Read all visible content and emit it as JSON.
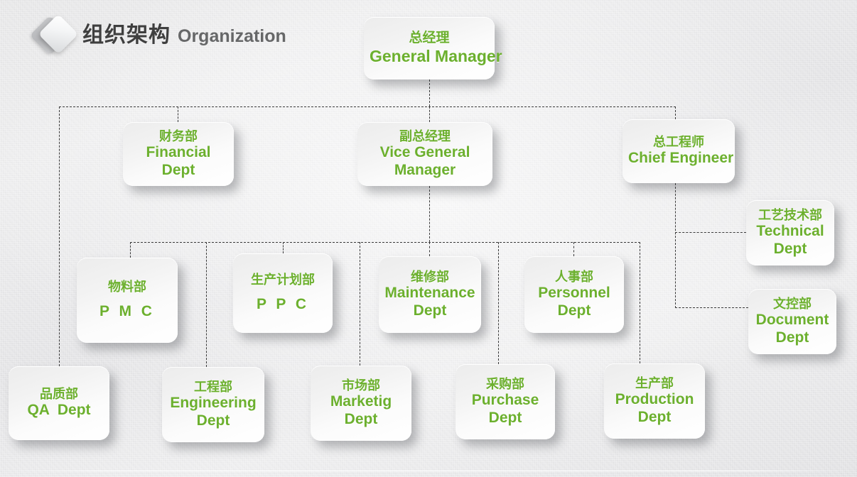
{
  "header": {
    "logo_icon": "diamond-logo-icon",
    "title_cn": "组织架构",
    "title_en": "Organization",
    "title_color": "#3f3f3f"
  },
  "theme": {
    "node_text_color": "#6cb02e",
    "connector_color": "#3a3a3a",
    "background": "#ebebec"
  },
  "chart_data": {
    "type": "diagram",
    "title": "组织架构 Organization",
    "nodes": [
      {
        "id": "gm",
        "cn": "总经理",
        "en": "General Manager",
        "level": 0
      },
      {
        "id": "financial",
        "cn": "财务部",
        "en": "Financial Dept",
        "level": 1
      },
      {
        "id": "vgm",
        "cn": "副总经理",
        "en": "Vice General Manager",
        "level": 1
      },
      {
        "id": "chief",
        "cn": "总工程师",
        "en": "Chief Engineer",
        "level": 1
      },
      {
        "id": "technical",
        "cn": "工艺技术部",
        "en": "Technical Dept",
        "level": 2
      },
      {
        "id": "document",
        "cn": "文控部",
        "en": "Document Dept",
        "level": 2
      },
      {
        "id": "pmc",
        "cn": "物料部",
        "en": "P M C",
        "level": 2
      },
      {
        "id": "ppc",
        "cn": "生产计划部",
        "en": "P P C",
        "level": 2
      },
      {
        "id": "maintenance",
        "cn": "维修部",
        "en": "Maintenance Dept",
        "level": 2
      },
      {
        "id": "personnel",
        "cn": "人事部",
        "en": "Personnel Dept",
        "level": 2
      },
      {
        "id": "qa",
        "cn": "品质部",
        "en": "QA  Dept",
        "level": 3
      },
      {
        "id": "engineering",
        "cn": "工程部",
        "en": "Engineering Dept",
        "level": 3
      },
      {
        "id": "marketing",
        "cn": "市场部",
        "en": "Marketig Dept",
        "level": 3
      },
      {
        "id": "purchase",
        "cn": "采购部",
        "en": "Purchase Dept",
        "level": 3
      },
      {
        "id": "production",
        "cn": "生产部",
        "en": "Production Dept",
        "level": 3
      }
    ],
    "edges": [
      {
        "from": "gm",
        "to": "financial"
      },
      {
        "from": "gm",
        "to": "vgm"
      },
      {
        "from": "gm",
        "to": "chief"
      },
      {
        "from": "gm",
        "to": "qa"
      },
      {
        "from": "chief",
        "to": "technical"
      },
      {
        "from": "chief",
        "to": "document"
      },
      {
        "from": "vgm",
        "to": "pmc"
      },
      {
        "from": "vgm",
        "to": "ppc"
      },
      {
        "from": "vgm",
        "to": "maintenance"
      },
      {
        "from": "vgm",
        "to": "personnel"
      },
      {
        "from": "vgm",
        "to": "engineering"
      },
      {
        "from": "vgm",
        "to": "marketing"
      },
      {
        "from": "vgm",
        "to": "purchase"
      },
      {
        "from": "vgm",
        "to": "production"
      }
    ]
  },
  "nodes": {
    "gm": {
      "cn": "总经理",
      "en": "General Manager"
    },
    "financial": {
      "cn": "财务部",
      "en_1": "Financial",
      "en_2": "Dept"
    },
    "vgm": {
      "cn": "副总经理",
      "en_1": "Vice General",
      "en_2": "Manager"
    },
    "chief": {
      "cn": "总工程师",
      "en": "Chief Engineer"
    },
    "technical": {
      "cn": "工艺技术部",
      "en_1": "Technical",
      "en_2": "Dept"
    },
    "document": {
      "cn": "文控部",
      "en_1": "Document",
      "en_2": "Dept"
    },
    "pmc": {
      "cn": "物料部",
      "en": "P M C"
    },
    "ppc": {
      "cn": "生产计划部",
      "en": "P P C"
    },
    "maintenance": {
      "cn": "维修部",
      "en_1": "Maintenance",
      "en_2": "Dept"
    },
    "personnel": {
      "cn": "人事部",
      "en_1": "Personnel",
      "en_2": "Dept"
    },
    "qa": {
      "cn": "品质部",
      "en": "QA  Dept"
    },
    "engineering": {
      "cn": "工程部",
      "en_1": "Engineering",
      "en_2": "Dept"
    },
    "marketing": {
      "cn": "市场部",
      "en_1": "Marketig",
      "en_2": "Dept"
    },
    "purchase": {
      "cn": "采购部",
      "en_1": "Purchase",
      "en_2": "Dept"
    },
    "production": {
      "cn": "生产部",
      "en_1": "Production",
      "en_2": "Dept"
    }
  }
}
